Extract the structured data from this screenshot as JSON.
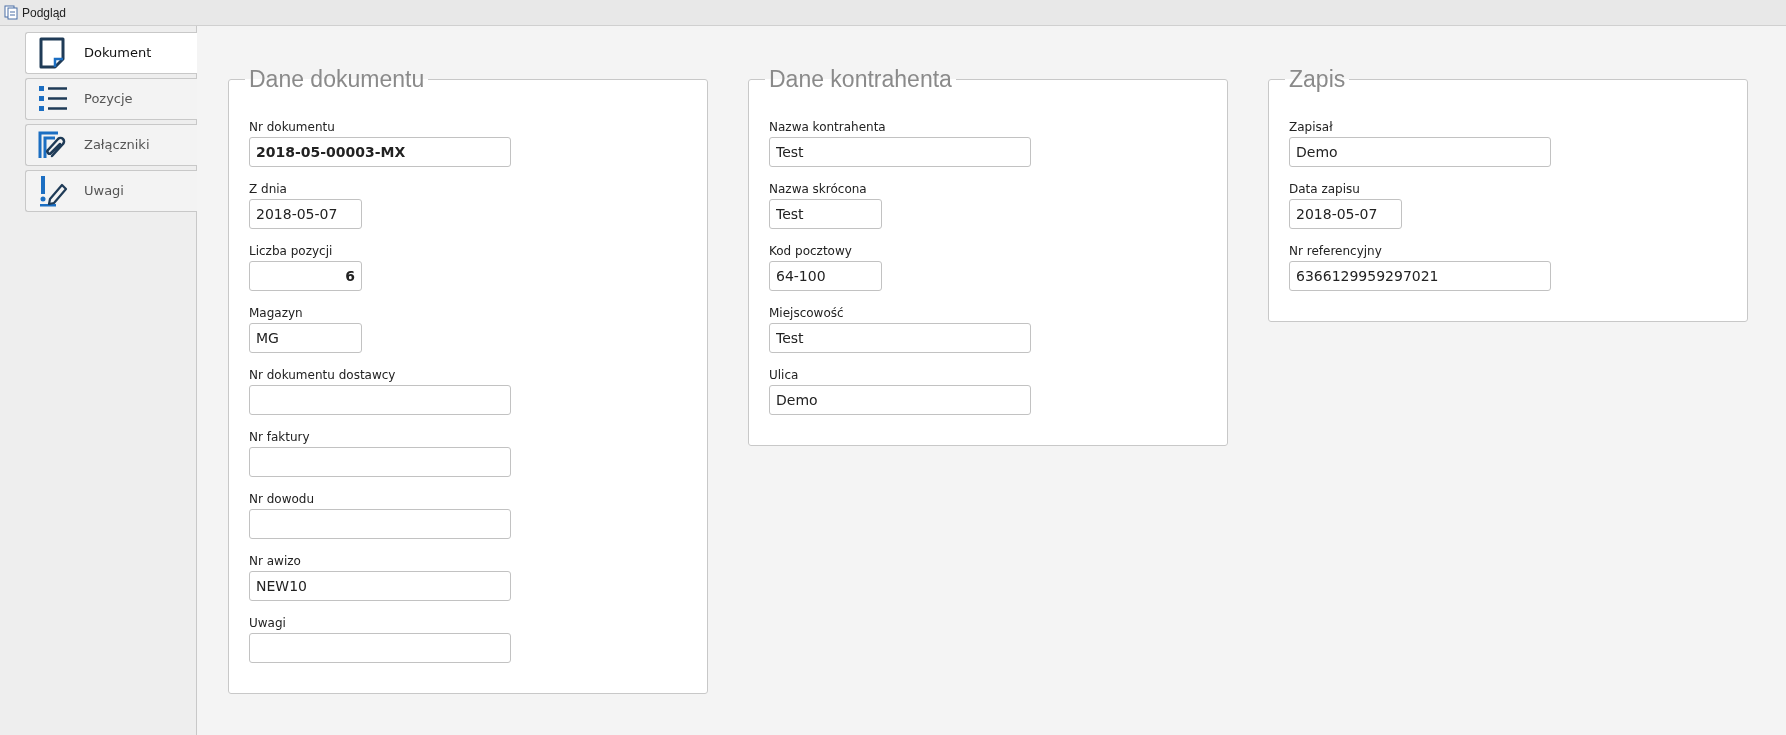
{
  "window": {
    "title": "Podgląd"
  },
  "tabs": [
    {
      "label": "Dokument",
      "selected": true
    },
    {
      "label": "Pozycje",
      "selected": false
    },
    {
      "label": "Załączniki",
      "selected": false
    },
    {
      "label": "Uwagi",
      "selected": false
    }
  ],
  "panels": [
    {
      "title": "Dane dokumentu",
      "fields": [
        {
          "label": "Nr dokumentu",
          "value": "2018-05-00003-MX",
          "kind": "code"
        },
        {
          "label": "Z dnia",
          "value": "2018-05-07",
          "kind": "short"
        },
        {
          "label": "Liczba pozycji",
          "value": "6",
          "kind": "number"
        },
        {
          "label": "Magazyn",
          "value": "MG",
          "kind": "short"
        },
        {
          "label": "Nr dokumentu dostawcy",
          "kind": "wide"
        },
        {
          "label": "Nr faktury",
          "kind": "wide"
        },
        {
          "label": "Nr dowodu",
          "kind": "wide"
        },
        {
          "label": "Nr awizo",
          "value": "NEW10",
          "kind": "wide"
        },
        {
          "label": "Uwagi",
          "kind": "wide"
        }
      ]
    },
    {
      "title": "Dane kontrahenta",
      "fields": [
        {
          "label": "Nazwa kontrahenta",
          "value": "Test",
          "kind": "wide"
        },
        {
          "label": "Nazwa skrócona",
          "value": "Test",
          "kind": "short"
        },
        {
          "label": "Kod pocztowy",
          "value": "64-100",
          "kind": "short"
        },
        {
          "label": "Miejscowość",
          "value": "Test",
          "kind": "wide"
        },
        {
          "label": "Ulica",
          "value": "Demo",
          "kind": "wide"
        }
      ]
    },
    {
      "title": "Zapis",
      "fields": [
        {
          "label": "Zapisał",
          "value": "Demo",
          "kind": "wide"
        },
        {
          "label": "Data zapisu",
          "value": "2018-05-07",
          "kind": "short"
        },
        {
          "label": "Nr referencyjny",
          "value": "6366129959297021",
          "kind": "wide"
        }
      ]
    }
  ]
}
